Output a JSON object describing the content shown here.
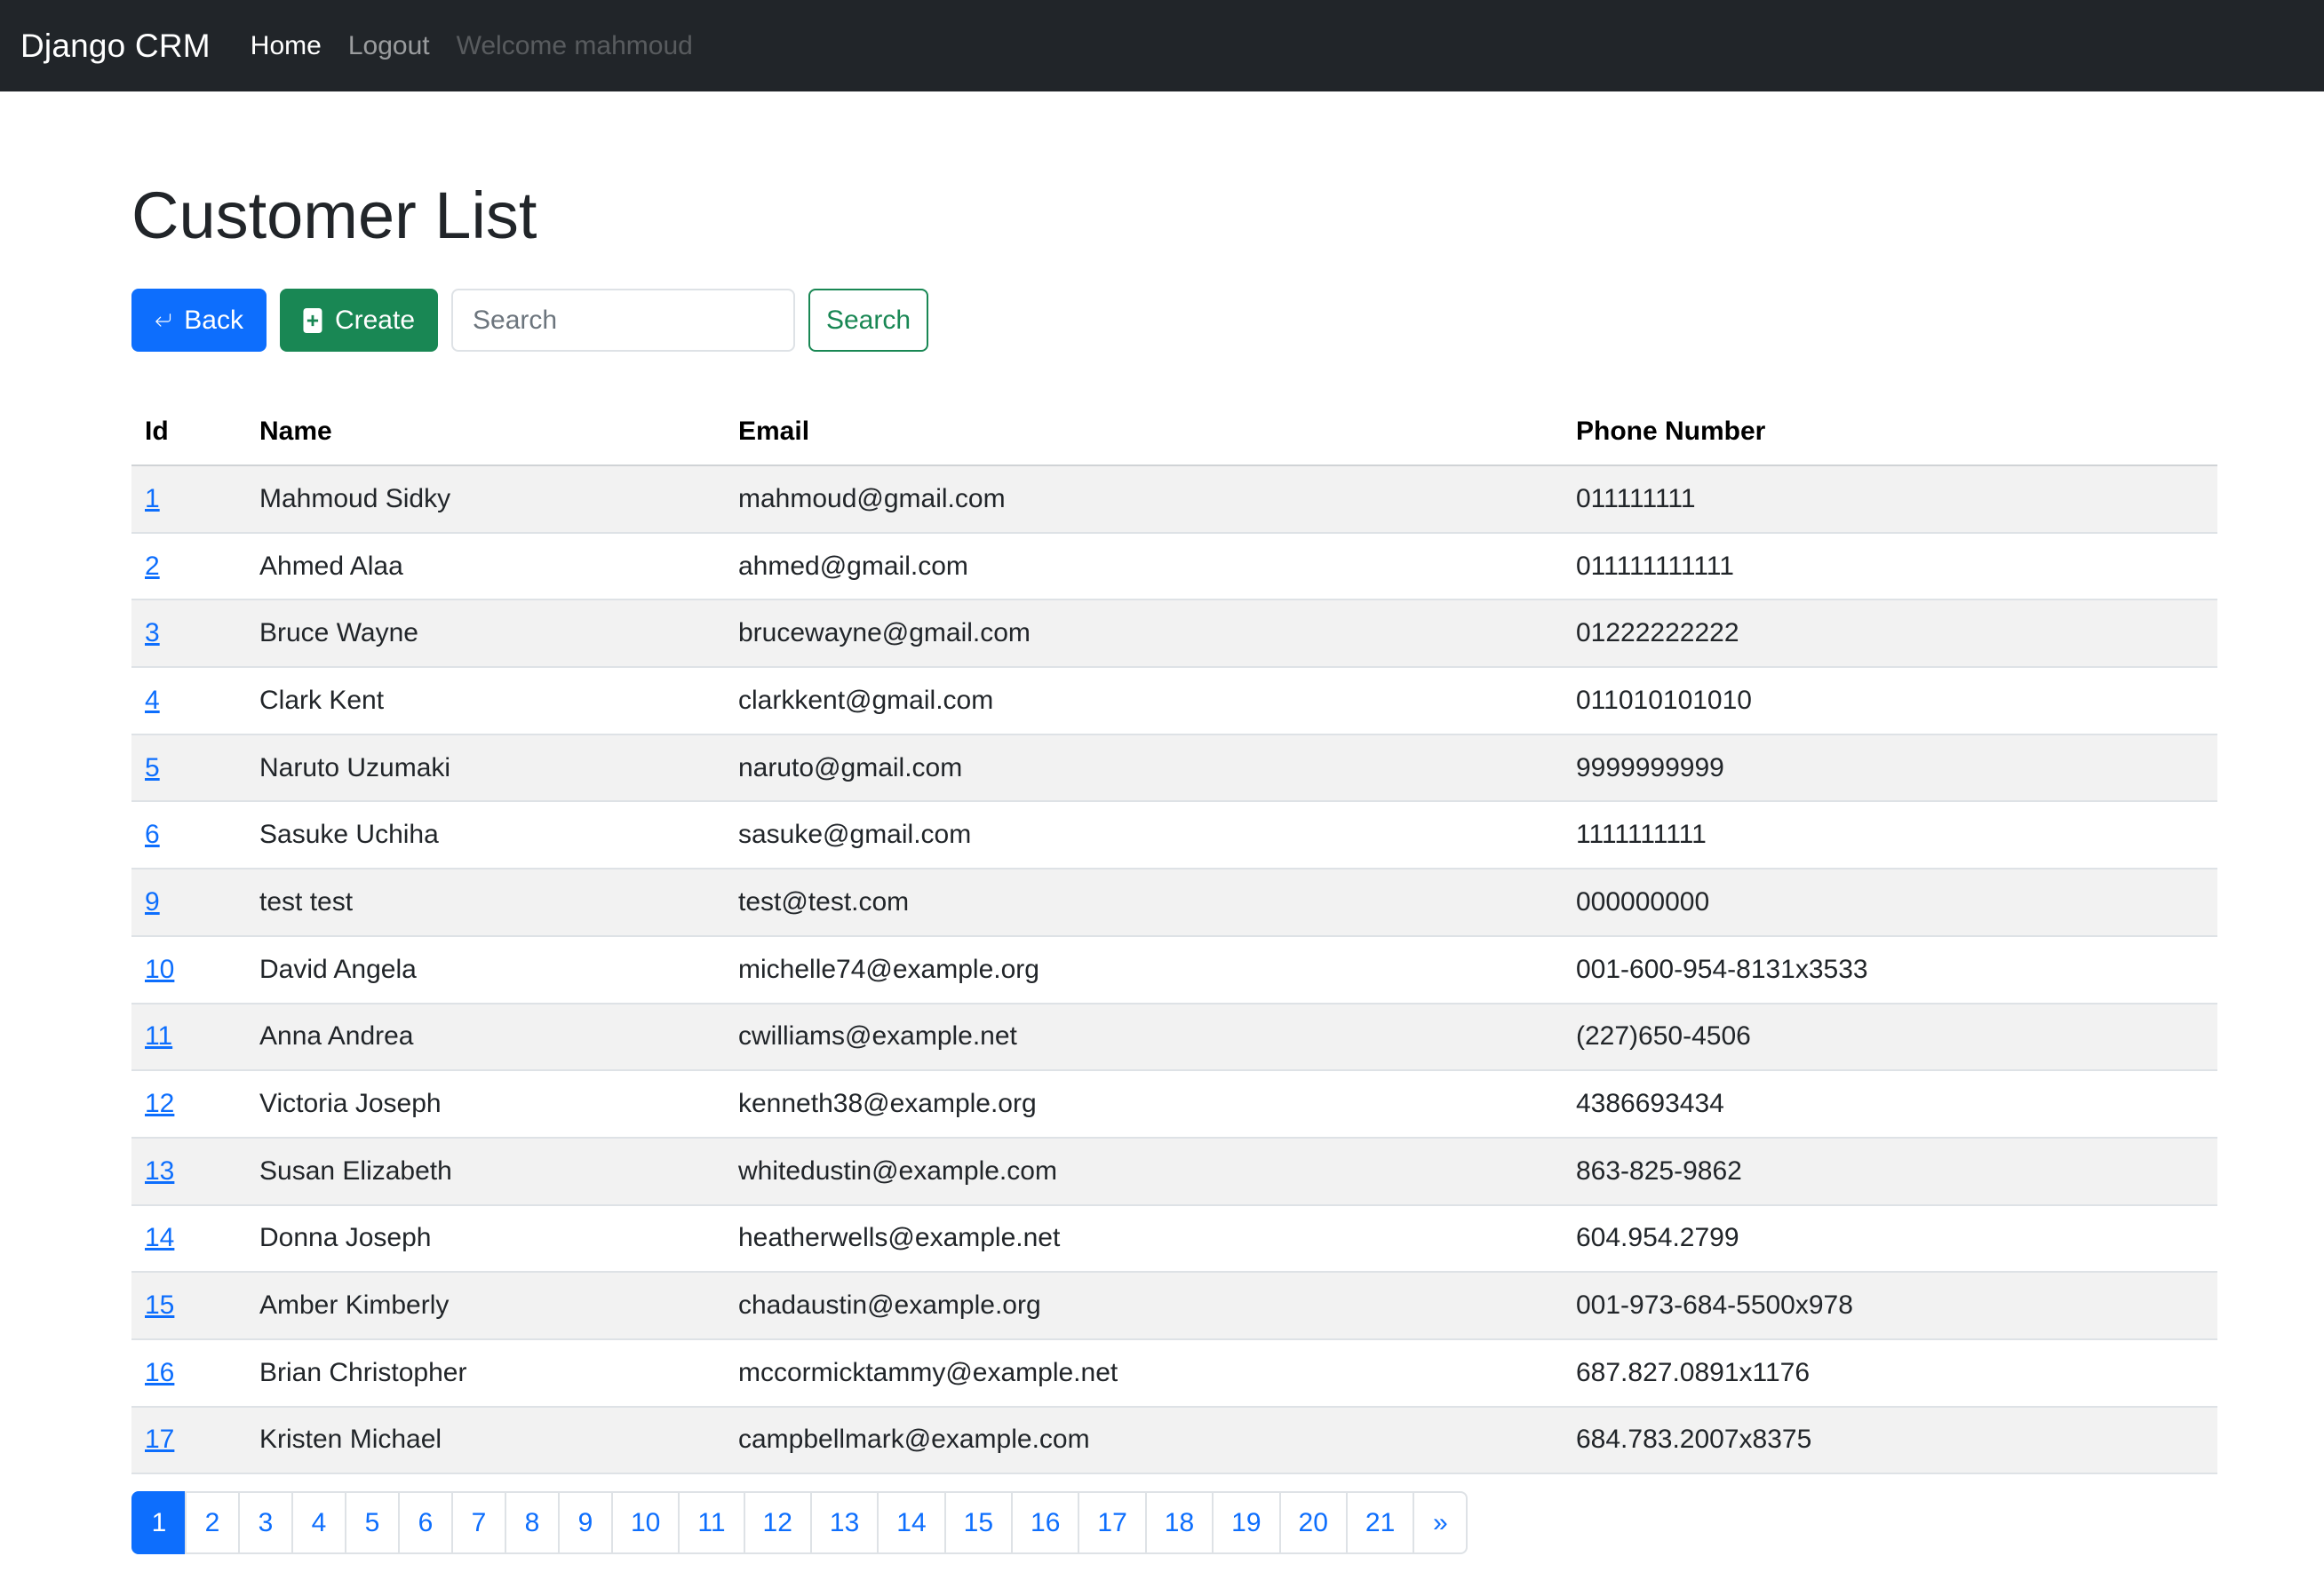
{
  "navbar": {
    "brand": "Django CRM",
    "home_label": "Home",
    "logout_label": "Logout",
    "welcome_text": "Welcome mahmoud"
  },
  "page": {
    "title": "Customer List"
  },
  "toolbar": {
    "back_label": "Back",
    "create_label": "Create",
    "search_placeholder": "Search",
    "search_value": "",
    "search_button_label": "Search"
  },
  "table": {
    "headers": {
      "id": "Id",
      "name": "Name",
      "email": "Email",
      "phone": "Phone Number"
    },
    "rows": [
      {
        "id": "1",
        "name": "Mahmoud Sidky",
        "email": "mahmoud@gmail.com",
        "phone": "011111111"
      },
      {
        "id": "2",
        "name": "Ahmed Alaa",
        "email": "ahmed@gmail.com",
        "phone": "011111111111"
      },
      {
        "id": "3",
        "name": "Bruce Wayne",
        "email": "brucewayne@gmail.com",
        "phone": "01222222222"
      },
      {
        "id": "4",
        "name": "Clark Kent",
        "email": "clarkkent@gmail.com",
        "phone": "011010101010"
      },
      {
        "id": "5",
        "name": "Naruto Uzumaki",
        "email": "naruto@gmail.com",
        "phone": "9999999999"
      },
      {
        "id": "6",
        "name": "Sasuke Uchiha",
        "email": "sasuke@gmail.com",
        "phone": "1111111111"
      },
      {
        "id": "9",
        "name": "test test",
        "email": "test@test.com",
        "phone": "000000000"
      },
      {
        "id": "10",
        "name": "David Angela",
        "email": "michelle74@example.org",
        "phone": "001-600-954-8131x3533"
      },
      {
        "id": "11",
        "name": "Anna Andrea",
        "email": "cwilliams@example.net",
        "phone": "(227)650-4506"
      },
      {
        "id": "12",
        "name": "Victoria Joseph",
        "email": "kenneth38@example.org",
        "phone": "4386693434"
      },
      {
        "id": "13",
        "name": "Susan Elizabeth",
        "email": "whitedustin@example.com",
        "phone": "863-825-9862"
      },
      {
        "id": "14",
        "name": "Donna Joseph",
        "email": "heatherwells@example.net",
        "phone": "604.954.2799"
      },
      {
        "id": "15",
        "name": "Amber Kimberly",
        "email": "chadaustin@example.org",
        "phone": "001-973-684-5500x978"
      },
      {
        "id": "16",
        "name": "Brian Christopher",
        "email": "mccormicktammy@example.net",
        "phone": "687.827.0891x1176"
      },
      {
        "id": "17",
        "name": "Kristen Michael",
        "email": "campbellmark@example.com",
        "phone": "684.783.2007x8375"
      }
    ]
  },
  "pagination": {
    "pages": [
      "1",
      "2",
      "3",
      "4",
      "5",
      "6",
      "7",
      "8",
      "9",
      "10",
      "11",
      "12",
      "13",
      "14",
      "15",
      "16",
      "17",
      "18",
      "19",
      "20",
      "21"
    ],
    "current": "1",
    "next_label": "»"
  },
  "colors": {
    "navbar_bg": "#212529",
    "primary": "#0d6efd",
    "success": "#198754",
    "stripe": "#f2f2f2"
  },
  "icons": {
    "back": "arrow-return-left-icon",
    "create": "file-plus-icon"
  }
}
